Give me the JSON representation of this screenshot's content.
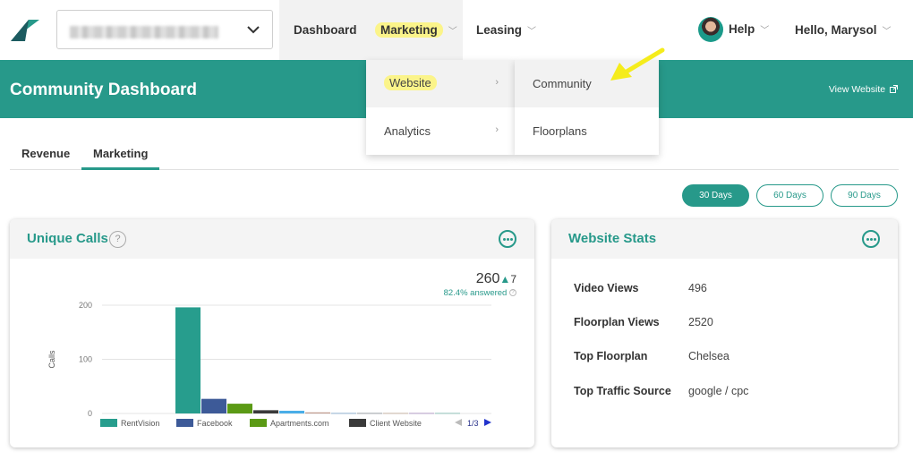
{
  "nav": {
    "items": [
      {
        "label": "Dashboard"
      },
      {
        "label": "Marketing"
      },
      {
        "label": "Leasing"
      }
    ],
    "help": "Help",
    "greeting": "Hello, Marysol"
  },
  "dropdown": {
    "left": [
      {
        "label": "Website"
      },
      {
        "label": "Analytics"
      }
    ],
    "right": [
      {
        "label": "Community"
      },
      {
        "label": "Floorplans"
      }
    ]
  },
  "header": {
    "title": "Community Dashboard",
    "view_website": "View Website"
  },
  "tabs": [
    {
      "label": "Revenue"
    },
    {
      "label": "Marketing"
    }
  ],
  "day_filters": [
    {
      "label": "30 Days"
    },
    {
      "label": "60 Days"
    },
    {
      "label": "90 Days"
    }
  ],
  "calls_card": {
    "title": "Unique Calls",
    "help": "?",
    "total": "260",
    "delta": "7",
    "answered": "82.4% answered",
    "legend_page": "1/3"
  },
  "stats_card": {
    "title": "Website Stats",
    "rows": [
      {
        "label": "Video Views",
        "value": "496"
      },
      {
        "label": "Floorplan Views",
        "value": "2520"
      },
      {
        "label": "Top Floorplan",
        "value": "Chelsea"
      },
      {
        "label": "Top Traffic Source",
        "value": "google / cpc"
      }
    ]
  },
  "colors": {
    "accent": "#27998a",
    "highlight": "#fbf48a",
    "pointer_arrow": "#f5ec1c"
  },
  "chart_data": {
    "type": "bar",
    "categories": [
      "RentVision",
      "Facebook",
      "Apartments.com",
      "Client Website"
    ],
    "series": [
      {
        "name": "RentVision",
        "color": "#279d8d",
        "value": 196
      },
      {
        "name": "Facebook",
        "color": "#3d5a98",
        "value": 27
      },
      {
        "name": "Apartments.com",
        "color": "#5b9a15",
        "value": 18
      },
      {
        "name": "Client Website",
        "color": "#3a3a3a",
        "value": 6
      },
      {
        "name": "",
        "color": "#4aaee8",
        "value": 5
      },
      {
        "name": "",
        "color": "#c09a8e",
        "value": 2
      },
      {
        "name": "",
        "color": "#8fb0cf",
        "value": 1
      },
      {
        "name": "",
        "color": "#9aa0a6",
        "value": 1
      },
      {
        "name": "",
        "color": "#c7b4a4",
        "value": 1
      },
      {
        "name": "",
        "color": "#b39cc5",
        "value": 1
      },
      {
        "name": "",
        "color": "#8fc0b8",
        "value": 1
      }
    ],
    "yticks": [
      "0",
      "100",
      "200"
    ],
    "ylabel": "Calls",
    "ylim": [
      0,
      200
    ]
  }
}
